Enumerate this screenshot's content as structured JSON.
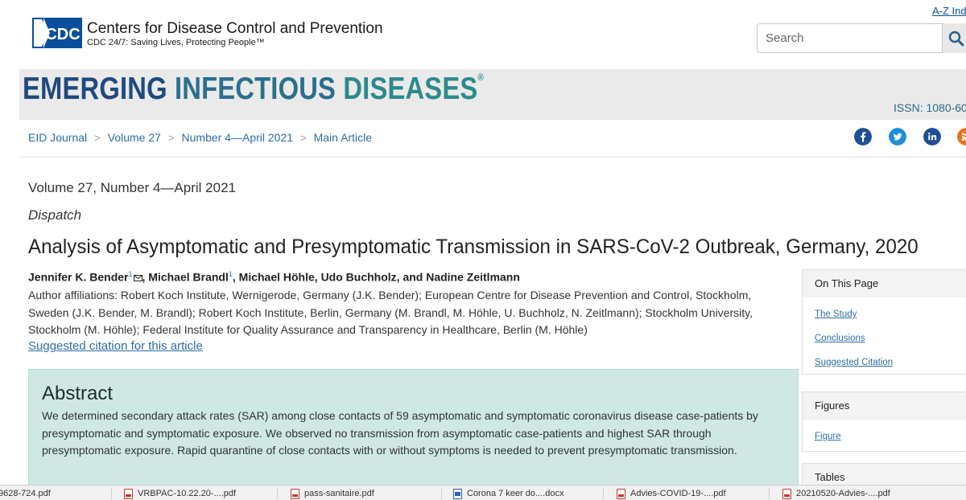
{
  "header": {
    "logo_text": "CDC",
    "title": "Centers for Disease Control and Prevention",
    "tagline": "CDC 24/7: Saving Lives, Protecting People™",
    "az_link": "A-Z Ind",
    "search": {
      "placeholder": "Search",
      "value": ""
    }
  },
  "banner": {
    "title_part1": "EMERGING",
    "title_part2": "INFECTIOUS",
    "title_part3": "DISEASES",
    "registered": "®",
    "issn": "ISSN: 1080-60"
  },
  "breadcrumb": {
    "items": [
      "EID Journal",
      "Volume 27",
      "Number 4—April 2021",
      "Main Article"
    ],
    "separator": ">"
  },
  "share_icons": [
    {
      "name": "facebook-icon",
      "color": "#1d4f91"
    },
    {
      "name": "twitter-icon",
      "color": "#1d8fd6"
    },
    {
      "name": "linkedin-icon",
      "color": "#1d4f91"
    },
    {
      "name": "rss-icon",
      "color": "#e8731c"
    }
  ],
  "article": {
    "volume_issue": "Volume 27, Number 4—April 2021",
    "type": "Dispatch",
    "title": "Analysis of Asymptomatic and Presymptomatic Transmission in SARS-CoV-2 Outbreak, Germany, 2020",
    "authors": {
      "a1": "Jennifer K. Bender",
      "a1_sup": "1",
      "a2": ", Michael Brandl",
      "a2_sup": "1",
      "rest": ", Michael Höhle, Udo Buchholz, and Nadine Zeitlmann"
    },
    "affiliations": "Author affiliations: Robert Koch Institute, Wernigerode, Germany (J.K. Bender); European Centre for Disease Prevention and Control, Stockholm, Sweden (J.K. Bender, M. Brandl); Robert Koch Institute, Berlin, Germany (M. Brandl, M. Höhle, U. Buchholz, N. Zeitlmann); Stockholm University, Stockholm (M. Höhle); Federal Institute for Quality Assurance and Transparency in Healthcare, Berlin (M. Höhle)",
    "citation_link": "Suggested citation for this article"
  },
  "abstract": {
    "heading": "Abstract",
    "body": "We determined secondary attack rates (SAR) among close contacts of 59 asymptomatic and symptomatic coronavirus disease case-patients by presymptomatic and symptomatic exposure. We observed no transmission from asymptomatic case-patients and highest SAR through presymptomatic exposure. Rapid quarantine of close contacts with or without symptoms is needed to prevent presymptomatic transmission."
  },
  "sidebar": {
    "on_this_page": {
      "heading": "On This Page",
      "links": [
        "The Study",
        "Conclusions",
        "Suggested Citation"
      ]
    },
    "figures": {
      "heading": "Figures",
      "links": [
        "Figure"
      ]
    },
    "tables": {
      "heading": "Tables"
    }
  },
  "downloads": [
    {
      "name": "9628-724.pdf",
      "type": "pdf"
    },
    {
      "name": "VRBPAC-10.22.20-....pdf",
      "type": "pdf"
    },
    {
      "name": "pass-sanitaire.pdf",
      "type": "pdf"
    },
    {
      "name": "Corona 7 keer do....docx",
      "type": "docx"
    },
    {
      "name": "Advies-COVID-19-....pdf",
      "type": "pdf"
    },
    {
      "name": "20210520-Advies-....pdf",
      "type": "pdf"
    }
  ]
}
